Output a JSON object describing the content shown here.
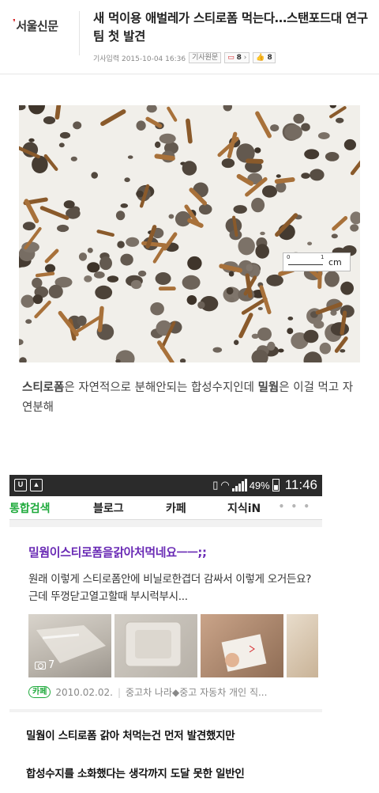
{
  "article": {
    "logo": "서울신문",
    "headline": "새 먹이용 애벌레가 스티로폼 먹는다…스탠포드대 연구팀 첫 발견",
    "date_label": "기사입력 2015-10-04 16:36",
    "original_label": "기사원문",
    "comment_count": "8",
    "like_count": "8"
  },
  "photo": {
    "scale_zero": "0",
    "scale_one": "1",
    "scale_unit": "cm"
  },
  "caption1": {
    "part1": "스티로폼",
    "part2": "은 자연적으로 분해안되는 합성수지인데 ",
    "part3": "밀웜",
    "part4": "은 이걸 먹고 자연분해"
  },
  "phone": {
    "status": {
      "battery": "49%",
      "time": "11:46"
    },
    "tabs": [
      "통합검색",
      "블로그",
      "카페",
      "지식iN"
    ],
    "tab_more": "• • •",
    "result": {
      "title": "밀웜이스티로폼을갉아처먹네요ㅡㅡ;;",
      "snippet": "원래 이렇게 스티로폼안에 비닐로한겹더 감싸서 이렇게 오거든요?근데 뚜껑닫고열고할때 부시럭부시...",
      "photo_count": "7",
      "badge": "카페",
      "date": "2010.02.02.",
      "source": "중고차 나라◆중고 자동차 개인 직..."
    }
  },
  "caption2": {
    "line1": "밀웜이 스티로폼 갉아 처먹는건 먼저 발견했지만",
    "line2": "합성수지를 소화했다는 생각까지 도달 못한 일반인"
  },
  "colors": {
    "accent_green": "#1faa3c",
    "title_purple": "#6a2bb5",
    "logo_red": "#d6262a"
  },
  "icons": [
    "comment-icon",
    "thumbs-up-icon",
    "camera-icon",
    "wifi-icon",
    "signal-icon",
    "battery-icon"
  ]
}
